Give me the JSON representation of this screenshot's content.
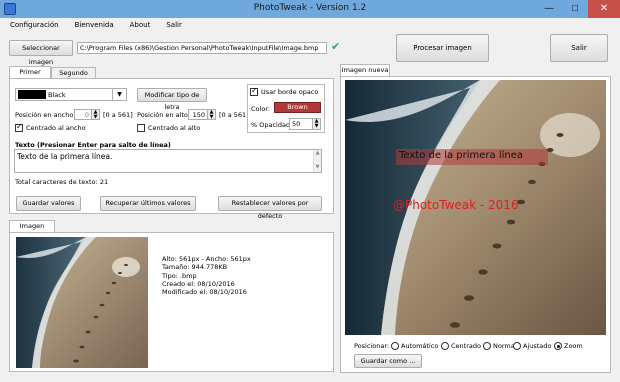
{
  "window": {
    "title": "PhotoTweak - Version 1.2",
    "min": "—",
    "max": "☐",
    "close": "✕"
  },
  "menu": [
    "Configuración",
    "Bienvenida",
    "About",
    "Salir"
  ],
  "file": {
    "select_label": "Seleccionar imagen",
    "path": "C:\\Program Files (x86)\\Gestion Personal\\PhotoTweak\\InputFile\\Image.bmp",
    "check": "✔"
  },
  "actions": {
    "process": "Procesar imagen",
    "exit": "Salir"
  },
  "tabs": {
    "first": "Primer texto",
    "second": "Segundo texto"
  },
  "text1": {
    "color": "Black",
    "color_hex": "#000000",
    "font_btn": "Modificar tipo de letra",
    "pos_x_label": "Posición en ancho:",
    "pos_x_value": "0",
    "pos_x_range": "[0 a 561]",
    "pos_y_label": "Posición en alto:",
    "pos_y_value": "150",
    "pos_y_range": "[0 a 561]",
    "center_x": "Centrado al ancho",
    "center_y": "Centrado al alto",
    "border_label": "Usar borde opaco",
    "border_color_label": "Color:",
    "border_color_value": "Brown",
    "border_color_hex": "#b03a3a",
    "opacity_label": "% Opacidad:",
    "opacity_value": "50",
    "text_label": "Texto (Presionar Enter para salto de línea)",
    "text_value": "Texto de la primera línea.",
    "char_count": "Total caracteres de texto: 21",
    "save_btn": "Guardar valores",
    "recover_btn": "Recuperar últimos valores",
    "reset_btn": "Restablecer valores por defecto"
  },
  "original": {
    "tab": "Imagen original",
    "info": [
      "Alto: 561px - Ancho: 561px",
      "Tamaño: 944.778KB",
      "Tipo:   .bmp",
      "Creado el:   08/10/2016",
      "Modificado el:   08/10/2016"
    ]
  },
  "preview": {
    "tab": "Imagen nueva",
    "text1": "Texto de la primera línea",
    "text2": "@PhotoTweak - 2016",
    "position_label": "Posicionar:",
    "options": [
      "Automático",
      "Centrado",
      "Normal",
      "Ajustado",
      "Zoom"
    ],
    "selected": "Zoom",
    "save_btn": "Guardar como ..."
  }
}
